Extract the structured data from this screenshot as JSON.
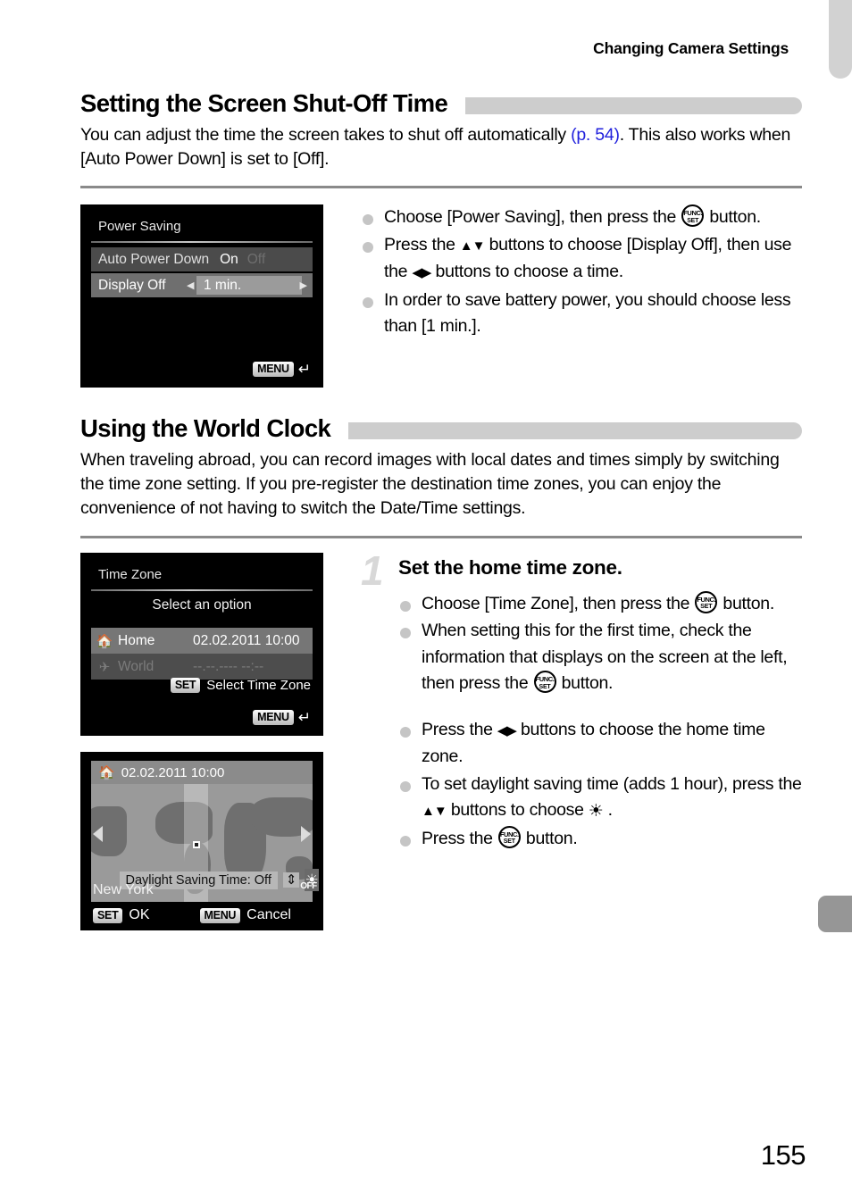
{
  "running_head": "Changing Camera Settings",
  "page_number": "155",
  "section1": {
    "heading": "Setting the Screen Shut-Off Time",
    "body_a": "You can adjust the time the screen takes to shut off automatically ",
    "body_link": "(p. 54)",
    "body_b": ". This also works when [Auto Power Down] is set to [Off].",
    "screen": {
      "title": "Power Saving",
      "row1_label": "Auto Power Down",
      "row1_on": "On",
      "row1_off": "Off",
      "row2_label": "Display Off",
      "row2_value": "1 min.",
      "menu_badge": "MENU"
    },
    "bullets": [
      {
        "a": "Choose [Power Saving], then press the ",
        "icon": "func-set-button",
        "b": " button."
      },
      {
        "a": "Press the ",
        "icon": "up-down-buttons",
        "b": " buttons to choose [Display Off], then use the ",
        "icon2": "left-right-buttons",
        "c": " buttons to choose a time."
      },
      {
        "a": "In order to save battery power, you should choose less than [1 min.].",
        "b": ""
      }
    ]
  },
  "section2": {
    "heading": "Using the World Clock",
    "body": "When traveling abroad, you can record images with local dates and times simply by switching the time zone setting. If you pre-register the destination time zones, you can enjoy the convenience of not having to switch the Date/Time settings.",
    "step_number": "1",
    "step_title": "Set the home time zone.",
    "screen_timezone": {
      "title": "Time Zone",
      "subtitle": "Select an option",
      "home_label": "Home",
      "home_value": "02.02.2011 10:00",
      "world_label": "World",
      "world_value": "--.--.---- --:--",
      "set_badge": "SET",
      "set_text": "Select Time Zone",
      "menu_badge": "MENU"
    },
    "screen_map": {
      "datetime": "02.02.2011 10:00",
      "dst_label": "Daylight Saving Time: Off",
      "sun_off_label": "OFF",
      "city": "New York",
      "set_badge": "SET",
      "ok_text": "OK",
      "menu_badge": "MENU",
      "cancel_text": "Cancel"
    },
    "bullets_a": [
      {
        "a": "Choose [Time Zone], then press the ",
        "icon": "func-set-button",
        "b": " button."
      },
      {
        "a": "When setting this for the first time, check the information that displays on the screen at the left, then press the ",
        "icon": "func-set-button",
        "b": " button."
      }
    ],
    "bullets_b": [
      {
        "a": "Press the ",
        "icon": "left-right-buttons",
        "b": " buttons to choose the home time zone."
      },
      {
        "a": "To set daylight saving time (adds 1 hour), press the ",
        "icon": "up-down-buttons",
        "b": " buttons to choose ",
        "icon2": "sun-icon",
        "c": " ."
      },
      {
        "a": "Press the ",
        "icon": "func-set-button",
        "b": " button."
      }
    ]
  },
  "colors": {
    "heading_bar": "#cdcdcd",
    "rule": "#8a8a8a",
    "link": "#2222dd",
    "bullet": "#c5c5c5",
    "step_num": "#d8d8d8",
    "tab_top": "#d2d2d2",
    "tab_mid": "#969696"
  }
}
